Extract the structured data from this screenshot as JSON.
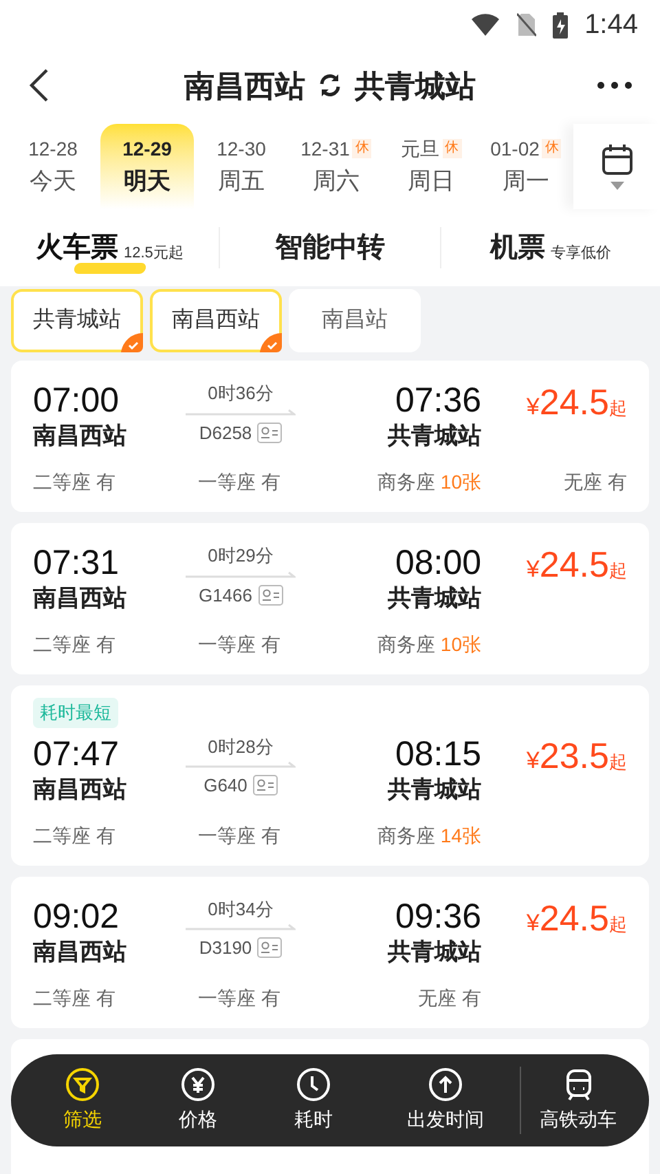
{
  "status_bar": {
    "time": "1:44"
  },
  "header": {
    "from": "南昌西站",
    "to": "共青城站"
  },
  "dates": [
    {
      "date": "12-28",
      "day": "今天",
      "selected": false,
      "holiday": false
    },
    {
      "date": "12-29",
      "day": "明天",
      "selected": true,
      "holiday": false
    },
    {
      "date": "12-30",
      "day": "周五",
      "selected": false,
      "holiday": false
    },
    {
      "date": "12-31",
      "day": "周六",
      "selected": false,
      "holiday": true,
      "badge": "休"
    },
    {
      "date": "元旦",
      "day": "周日",
      "selected": false,
      "holiday": true,
      "badge": "休"
    },
    {
      "date": "01-02",
      "day": "周一",
      "selected": false,
      "holiday": true,
      "badge": "休"
    }
  ],
  "modes": [
    {
      "label": "火车票",
      "note": "12.5元起",
      "selected": true
    },
    {
      "label": "智能中转",
      "selected": false
    },
    {
      "label": "机票",
      "note": "专享低价",
      "selected": false
    }
  ],
  "station_filters": [
    {
      "label": "共青城站",
      "selected": true
    },
    {
      "label": "南昌西站",
      "selected": true
    },
    {
      "label": "南昌站",
      "selected": false
    }
  ],
  "trains": [
    {
      "dep_time": "07:00",
      "dep_station": "南昌西站",
      "duration": "0时36分",
      "train_no": "D6258",
      "arr_time": "07:36",
      "arr_station": "共青城站",
      "price_symbol": "¥",
      "price": "24.5",
      "price_suffix": "起",
      "seats": [
        {
          "name": "二等座",
          "avail": "有",
          "highlight": false
        },
        {
          "name": "一等座",
          "avail": "有",
          "highlight": false
        },
        {
          "name": "商务座",
          "avail": "10张",
          "highlight": true
        },
        {
          "name": "无座",
          "avail": "有",
          "highlight": false
        }
      ]
    },
    {
      "dep_time": "07:31",
      "dep_station": "南昌西站",
      "duration": "0时29分",
      "train_no": "G1466",
      "arr_time": "08:00",
      "arr_station": "共青城站",
      "price_symbol": "¥",
      "price": "24.5",
      "price_suffix": "起",
      "seats": [
        {
          "name": "二等座",
          "avail": "有",
          "highlight": false
        },
        {
          "name": "一等座",
          "avail": "有",
          "highlight": false
        },
        {
          "name": "商务座",
          "avail": "10张",
          "highlight": true
        }
      ]
    },
    {
      "tag": "耗时最短",
      "dep_time": "07:47",
      "dep_station": "南昌西站",
      "duration": "0时28分",
      "train_no": "G640",
      "arr_time": "08:15",
      "arr_station": "共青城站",
      "price_symbol": "¥",
      "price": "23.5",
      "price_suffix": "起",
      "seats": [
        {
          "name": "二等座",
          "avail": "有",
          "highlight": false
        },
        {
          "name": "一等座",
          "avail": "有",
          "highlight": false
        },
        {
          "name": "商务座",
          "avail": "14张",
          "highlight": true
        }
      ]
    },
    {
      "dep_time": "09:02",
      "dep_station": "南昌西站",
      "duration": "0时34分",
      "train_no": "D3190",
      "arr_time": "09:36",
      "arr_station": "共青城站",
      "price_symbol": "¥",
      "price": "24.5",
      "price_suffix": "起",
      "seats": [
        {
          "name": "二等座",
          "avail": "有",
          "highlight": false
        },
        {
          "name": "一等座",
          "avail": "有",
          "highlight": false
        },
        {
          "name": "无座",
          "avail": "有",
          "highlight": false
        }
      ]
    }
  ],
  "sort_bar": [
    {
      "kind": "filter",
      "label": "筛选",
      "selected": true
    },
    {
      "kind": "price",
      "label": "价格",
      "selected": false
    },
    {
      "kind": "duration",
      "label": "耗时",
      "selected": false
    },
    {
      "kind": "departure",
      "label": "出发时间",
      "selected": false
    },
    {
      "kind": "train",
      "label": "高铁动车",
      "selected": false
    }
  ]
}
